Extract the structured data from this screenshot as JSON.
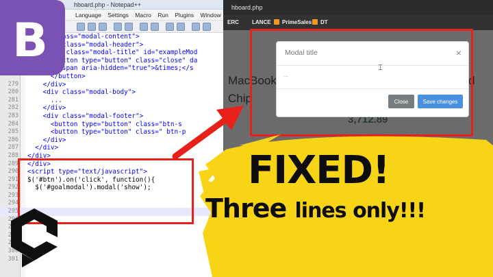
{
  "editor": {
    "title": "hboard.php - Notepad++",
    "menu": [
      "Language",
      "Settings",
      "Macro",
      "Run",
      "Plugins",
      "Window",
      "?"
    ],
    "lines": [
      {
        "num": "",
        "code": "  <div class=\"modal-content\">"
      },
      {
        "num": "",
        "code": "    <div class=\"modal-header\">"
      },
      {
        "num": "",
        "code": "      <h5 class=\"modal-title\" id=\"exampleMod"
      },
      {
        "num": "",
        "code": "      <button type=\"button\" class=\"close\" da"
      },
      {
        "num": "",
        "code": "        <span aria-hidden=\"true\">&times;</s"
      },
      {
        "num": "",
        "code": "      </button>"
      },
      {
        "num": "279",
        "code": "    </div>"
      },
      {
        "num": "280",
        "code": "    <div class=\"modal-body\">"
      },
      {
        "num": "281",
        "code": "      ..."
      },
      {
        "num": "282",
        "code": "    </div>"
      },
      {
        "num": "283",
        "code": "    <div class=\"modal-footer\">"
      },
      {
        "num": "284",
        "code": "      <button type=\"button\" class=\"btn-s"
      },
      {
        "num": "285",
        "code": "      <button type=\"button\" class=\" btn-p"
      },
      {
        "num": "286",
        "code": "    </div>"
      },
      {
        "num": "287",
        "code": "  </div>"
      },
      {
        "num": "288",
        "code": "</div>"
      },
      {
        "num": "289",
        "code": "</div>"
      },
      {
        "num": "290",
        "code": "<script type=\"text/javascript\">"
      },
      {
        "num": "291",
        "code": "$('#btn').on('click', function(){"
      },
      {
        "num": "292",
        "code": "  $('#goalmodal').modal('show');"
      },
      {
        "num": "293",
        "code": ""
      },
      {
        "num": "294",
        "code": ""
      },
      {
        "num": "295",
        "code": ""
      },
      {
        "num": "296",
        "code": ""
      },
      {
        "num": "297",
        "code": ""
      },
      {
        "num": "298",
        "code": ""
      },
      {
        "num": "299",
        "code": ""
      },
      {
        "num": "300",
        "code": ""
      },
      {
        "num": "301",
        "code": ""
      }
    ]
  },
  "browser": {
    "tab_title": "hboard.php",
    "bookmarks": [
      "ERC",
      "LANCE",
      "PrimeSales",
      "DT"
    ],
    "page_text_1": "MacBook F",
    "page_text_2": "Chip",
    "page_text_3": "d",
    "page_value": "3,712.89"
  },
  "modal": {
    "title": "Modal title",
    "close_symbol": "×",
    "body": "...",
    "close_label": "Close",
    "save_label": "Save changes"
  },
  "overlay": {
    "headline": "FIXED!",
    "sub_big": "Three",
    "sub_small": "lines only!!!"
  },
  "badge": {
    "letter": "B"
  },
  "colors": {
    "red": "#e8201a",
    "yellow": "#f8d416",
    "bootstrap_purple": "#7952b3",
    "save_blue": "#4b8fe0"
  }
}
